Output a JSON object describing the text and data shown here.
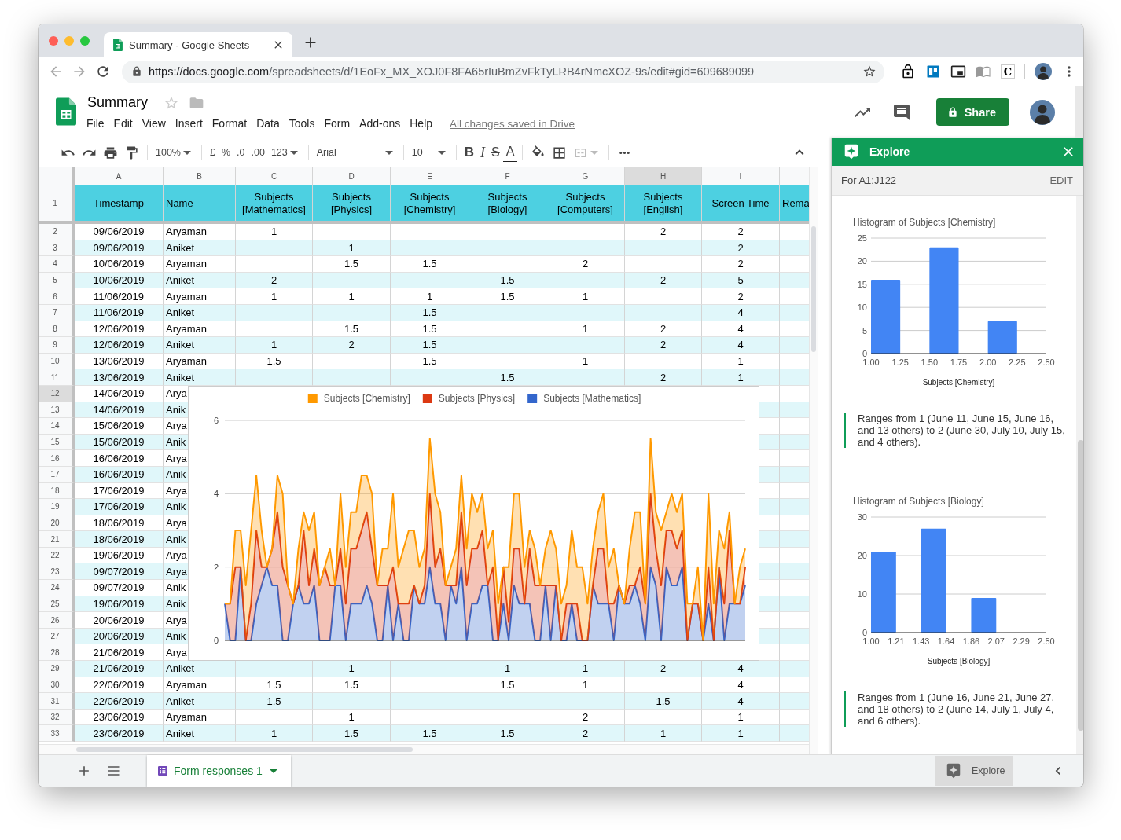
{
  "browser": {
    "tab_title": "Summary - Google Sheets",
    "url_origin": "https://docs.google.com",
    "url_path": "/spreadsheets/d/1EoFx_MX_XOJ0F8FA65rIuBmZvFkTyLRB4rNmcXOZ-9s/edit#gid=609689099",
    "extension_letter": "C"
  },
  "app": {
    "title": "Summary",
    "menu": [
      "File",
      "Edit",
      "View",
      "Insert",
      "Format",
      "Data",
      "Tools",
      "Form",
      "Add-ons",
      "Help"
    ],
    "save_status": "All changes saved in Drive",
    "share_label": "Share"
  },
  "toolbar": {
    "zoom": "100%",
    "currency": "£",
    "percent": "%",
    "decimal_decrease": ".0",
    "decimal_increase": ".00",
    "number_format": "123",
    "font": "Arial",
    "font_size": "10",
    "bold": "B",
    "italic": "I",
    "strikethrough": "S",
    "text_color": "A"
  },
  "grid": {
    "columns": [
      {
        "letter": "A",
        "selected": false
      },
      {
        "letter": "B",
        "selected": false
      },
      {
        "letter": "C",
        "selected": false
      },
      {
        "letter": "D",
        "selected": false
      },
      {
        "letter": "E",
        "selected": false
      },
      {
        "letter": "F",
        "selected": false
      },
      {
        "letter": "G",
        "selected": false
      },
      {
        "letter": "H",
        "selected": true
      },
      {
        "letter": "I",
        "selected": false
      }
    ],
    "header_row": {
      "number": "1",
      "cells": [
        "Timestamp",
        "Name",
        "Subjects [Mathematics]",
        "Subjects [Physics]",
        "Subjects [Chemistry]",
        "Subjects [Biology]",
        "Subjects [Computers]",
        "Subjects [English]",
        "Screen Time",
        "Rema"
      ]
    },
    "rows": [
      {
        "number": "2",
        "selected": false,
        "cells": [
          "09/06/2019",
          "Aryaman",
          "1",
          null,
          null,
          null,
          null,
          "2",
          "2"
        ]
      },
      {
        "number": "3",
        "selected": false,
        "cells": [
          "09/06/2019",
          "Aniket",
          null,
          "1",
          null,
          null,
          null,
          null,
          "2"
        ]
      },
      {
        "number": "4",
        "selected": false,
        "cells": [
          "10/06/2019",
          "Aryaman",
          null,
          "1.5",
          "1.5",
          null,
          "2",
          null,
          "2"
        ]
      },
      {
        "number": "5",
        "selected": false,
        "cells": [
          "10/06/2019",
          "Aniket",
          "2",
          null,
          null,
          "1.5",
          null,
          "2",
          "5"
        ]
      },
      {
        "number": "6",
        "selected": false,
        "cells": [
          "11/06/2019",
          "Aryaman",
          "1",
          "1",
          "1",
          "1.5",
          "1",
          null,
          "2"
        ]
      },
      {
        "number": "7",
        "selected": false,
        "cells": [
          "11/06/2019",
          "Aniket",
          null,
          null,
          "1.5",
          null,
          null,
          null,
          "4"
        ]
      },
      {
        "number": "8",
        "selected": false,
        "cells": [
          "12/06/2019",
          "Aryaman",
          null,
          "1.5",
          "1.5",
          null,
          "1",
          "2",
          "4"
        ]
      },
      {
        "number": "9",
        "selected": false,
        "cells": [
          "12/06/2019",
          "Aniket",
          "1",
          "2",
          "1.5",
          null,
          null,
          "2",
          "4"
        ]
      },
      {
        "number": "10",
        "selected": false,
        "cells": [
          "13/06/2019",
          "Aryaman",
          "1.5",
          null,
          "1.5",
          null,
          "1",
          null,
          "1"
        ]
      },
      {
        "number": "11",
        "selected": false,
        "cells": [
          "13/06/2019",
          "Aniket",
          null,
          null,
          null,
          "1.5",
          null,
          "2",
          "1"
        ]
      },
      {
        "number": "12",
        "selected": true,
        "cells": [
          "14/06/2019",
          "Arya"
        ]
      },
      {
        "number": "13",
        "selected": false,
        "cells": [
          "14/06/2019",
          "Anik"
        ]
      },
      {
        "number": "14",
        "selected": false,
        "cells": [
          "15/06/2019",
          "Arya"
        ]
      },
      {
        "number": "15",
        "selected": false,
        "cells": [
          "15/06/2019",
          "Anik"
        ]
      },
      {
        "number": "16",
        "selected": false,
        "cells": [
          "16/06/2019",
          "Arya"
        ]
      },
      {
        "number": "17",
        "selected": false,
        "cells": [
          "16/06/2019",
          "Anik"
        ]
      },
      {
        "number": "18",
        "selected": false,
        "cells": [
          "17/06/2019",
          "Arya"
        ]
      },
      {
        "number": "19",
        "selected": false,
        "cells": [
          "17/06/2019",
          "Anik"
        ]
      },
      {
        "number": "20",
        "selected": false,
        "cells": [
          "18/06/2019",
          "Arya"
        ]
      },
      {
        "number": "21",
        "selected": false,
        "cells": [
          "18/06/2019",
          "Anik"
        ]
      },
      {
        "number": "22",
        "selected": false,
        "cells": [
          "19/06/2019",
          "Arya"
        ]
      },
      {
        "number": "23",
        "selected": false,
        "cells": [
          "09/07/2019",
          "Arya"
        ]
      },
      {
        "number": "24",
        "selected": false,
        "cells": [
          "09/07/2019",
          "Anik"
        ]
      },
      {
        "number": "25",
        "selected": false,
        "cells": [
          "19/06/2019",
          "Anik"
        ]
      },
      {
        "number": "26",
        "selected": false,
        "cells": [
          "20/06/2019",
          "Arya"
        ]
      },
      {
        "number": "27",
        "selected": false,
        "cells": [
          "20/06/2019",
          "Anik"
        ]
      },
      {
        "number": "28",
        "selected": false,
        "cells": [
          "21/06/2019",
          "Arya"
        ]
      },
      {
        "number": "29",
        "selected": false,
        "cells": [
          "21/06/2019",
          "Aniket",
          null,
          "1",
          null,
          "1",
          "1",
          "2",
          "4"
        ]
      },
      {
        "number": "30",
        "selected": false,
        "cells": [
          "22/06/2019",
          "Aryaman",
          "1.5",
          "1.5",
          null,
          "1.5",
          "1",
          null,
          "4"
        ]
      },
      {
        "number": "31",
        "selected": false,
        "cells": [
          "22/06/2019",
          "Aniket",
          "1.5",
          null,
          null,
          null,
          null,
          "1.5",
          "4"
        ]
      },
      {
        "number": "32",
        "selected": false,
        "cells": [
          "23/06/2019",
          "Aryaman",
          null,
          "1",
          null,
          null,
          "2",
          null,
          "1"
        ]
      },
      {
        "number": "33",
        "selected": false,
        "cells": [
          "23/06/2019",
          "Aniket",
          "1",
          "1.5",
          "1.5",
          "1.5",
          "2",
          "1",
          "1"
        ]
      }
    ]
  },
  "chart": {
    "chart_data": {
      "type": "area",
      "stacked": true,
      "legend": true,
      "ylim": [
        0,
        6
      ],
      "yticks": [
        0,
        2,
        4,
        6
      ],
      "series": [
        {
          "name": "Subjects [Chemistry]",
          "color": "#ff9900",
          "values": [
            0,
            0,
            1,
            1,
            1.5,
            2,
            1.5,
            1,
            0,
            0,
            1,
            2,
            0,
            0,
            1,
            0.5,
            1.5,
            1,
            0,
            0,
            1,
            0,
            1.5,
            1,
            1,
            1,
            1.5,
            1,
            1.5,
            0,
            1,
            1,
            2,
            1,
            1.5,
            2,
            1.5,
            1,
            1,
            1.5,
            2,
            1,
            0,
            0.5,
            1,
            1,
            1,
            1.5,
            1,
            1,
            1,
            1,
            1,
            0,
            1.5,
            1.5,
            1.5,
            1,
            0.5,
            1,
            0,
            1,
            1.5,
            1,
            1,
            0.5,
            2,
            1,
            2,
            1,
            1,
            1,
            1.5,
            1,
            1.5,
            0,
            0,
            1,
            2,
            1.5,
            0,
            1.5,
            1,
            1.5,
            0.5,
            1,
            1,
            1,
            1,
            0,
            1,
            0,
            2,
            1,
            1,
            1.5,
            0.5,
            0,
            1,
            0.5
          ]
        },
        {
          "name": "Subjects [Physics]",
          "color": "#dc3912",
          "values": [
            0,
            1,
            2,
            0,
            0,
            1,
            2,
            0.5,
            0,
            1,
            2,
            2,
            1.5,
            0,
            0,
            2,
            0.5,
            1,
            1.5,
            2,
            1.5,
            0,
            1,
            1,
            1.5,
            1.5,
            2,
            2,
            1.5,
            1.5,
            1.5,
            0,
            2,
            0,
            1,
            1,
            0,
            0,
            0.5,
            2,
            1,
            1.5,
            1.5,
            0,
            0.5,
            1.5,
            1.5,
            1.5,
            1.5,
            1.5,
            0,
            2,
            0,
            1,
            0.5,
            1,
            1.5,
            0,
            1.5,
            1.5,
            1.5,
            0,
            1.5,
            0,
            0,
            1,
            0,
            1,
            0,
            0,
            0,
            1.5,
            1.5,
            0,
            1,
            0,
            0,
            0.5,
            0,
            1,
            1,
            2,
            1,
            1.5,
            1,
            1.5,
            1,
            1,
            0,
            0,
            0,
            0,
            1,
            0,
            0,
            1,
            2,
            0,
            0,
            0.5
          ]
        },
        {
          "name": "Subjects [Mathematics]",
          "color": "#3366cc",
          "values": [
            1,
            0,
            0,
            2,
            0,
            0,
            1,
            1.5,
            2,
            1.5,
            1.5,
            0,
            0,
            1,
            1.5,
            1,
            1,
            1.5,
            0,
            0,
            0,
            1.5,
            1.5,
            0,
            1,
            1,
            1,
            1.5,
            1,
            0,
            0,
            1.5,
            0,
            1,
            0,
            0,
            1.5,
            1,
            1,
            2,
            1,
            1,
            0,
            1.5,
            1,
            2,
            0,
            1,
            1,
            1.5,
            1.5,
            0,
            0,
            1,
            0,
            1.5,
            1,
            1,
            1,
            0,
            0,
            1.5,
            0,
            1.5,
            0,
            0,
            1,
            0,
            0,
            0,
            1.5,
            1,
            1,
            1,
            0,
            1.5,
            1,
            1,
            1.5,
            1,
            0,
            2,
            1.5,
            0,
            2,
            1.5,
            1.5,
            2,
            0,
            1,
            1,
            0,
            1,
            0,
            2,
            0,
            1,
            1,
            1,
            1.5
          ]
        }
      ]
    }
  },
  "explore": {
    "title": "Explore",
    "range": "For A1:J122",
    "edit": "EDIT",
    "cards": [
      {
        "chart_data": {
          "type": "bar",
          "title": "Histogram of Subjects [Chemistry]",
          "xlabel": "Subjects [Chemistry]",
          "x": [
            1.125,
            1.625,
            2.125
          ],
          "values": [
            16,
            23,
            7
          ],
          "grid": true,
          "color": "#4285f4",
          "xlim": [
            1,
            2.5
          ],
          "ylim": [
            0,
            25
          ],
          "yticks": [
            0,
            5,
            10,
            15,
            20,
            25
          ],
          "xticks": [
            {
              "value": 1.0,
              "label": "1.00"
            },
            {
              "value": 1.25,
              "label": "1.25"
            },
            {
              "value": 1.5,
              "label": "1.50"
            },
            {
              "value": 1.75,
              "label": "1.75"
            },
            {
              "value": 2.0,
              "label": "2.00"
            },
            {
              "value": 2.25,
              "label": "2.25"
            },
            {
              "value": 2.5,
              "label": "2.50"
            }
          ]
        },
        "summary": "Ranges from 1 (June 11, June 15, June 16, and 13 others) to 2 (June 30, July 10, July 15, and 4 others)."
      },
      {
        "chart_data": {
          "type": "bar",
          "title": "Histogram of Subjects [Biology]",
          "xlabel": "Subjects [Biology]",
          "x": [
            1.1071,
            1.5357,
            1.9643
          ],
          "values": [
            21,
            27,
            9
          ],
          "grid": true,
          "color": "#4285f4",
          "xlim": [
            1,
            2.5
          ],
          "ylim": [
            0,
            30
          ],
          "yticks": [
            0,
            10,
            20,
            30
          ],
          "xticks": [
            {
              "value": 1.0,
              "label": "1.00"
            },
            {
              "value": 1.2143,
              "label": "1.21"
            },
            {
              "value": 1.4286,
              "label": "1.43"
            },
            {
              "value": 1.6429,
              "label": "1.64"
            },
            {
              "value": 1.8571,
              "label": "1.86"
            },
            {
              "value": 2.0714,
              "label": "2.07"
            },
            {
              "value": 2.2857,
              "label": "2.29"
            },
            {
              "value": 2.5,
              "label": "2.50"
            }
          ]
        },
        "summary": "Ranges from 1 (June 16, June 21, June 27, and 18 others) to 2 (June 14, July 1, July 4, and 6 others)."
      }
    ]
  },
  "sheet_tabs": [
    {
      "label": "Form responses 1",
      "selected": true
    }
  ],
  "explore_button": "Explore"
}
